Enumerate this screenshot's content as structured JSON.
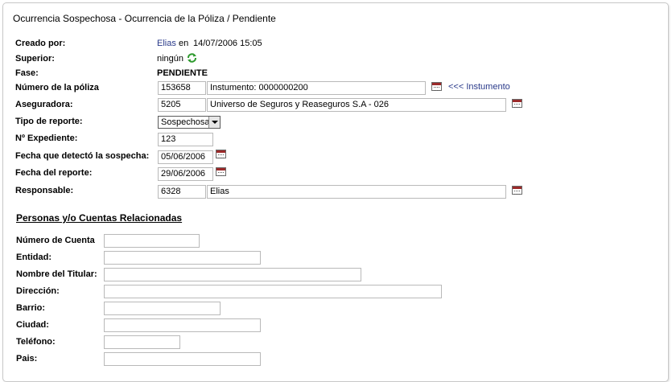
{
  "header": {
    "title": "Ocurrencia Sospechosa - Ocurrencia de la Póliza / Pendiente"
  },
  "form": {
    "creado_por": {
      "label": "Creado por:",
      "user": "Elias",
      "connector": "en",
      "datetime": "14/07/2006 15:05"
    },
    "superior": {
      "label": "Superior:",
      "value": "ningún",
      "icon": "refresh-icon"
    },
    "fase": {
      "label": "Fase:",
      "value": "PENDIENTE"
    },
    "numero_poliza": {
      "label": "Número de la póliza",
      "code": "153658",
      "description": "Instumento: 0000000200",
      "link": "<<< Instumento"
    },
    "aseguradora": {
      "label": "Aseguradora:",
      "code": "5205",
      "name": "Universo de Seguros y Reaseguros S.A - 026"
    },
    "tipo_reporte": {
      "label": "Tipo de reporte:",
      "selected": "Sospechosa"
    },
    "expediente": {
      "label": "Nº Expediente:",
      "value": "123"
    },
    "fecha_detecto": {
      "label": "Fecha que detectó la sospecha:",
      "value": "05/06/2006"
    },
    "fecha_reporte": {
      "label": "Fecha del reporte:",
      "value": "29/06/2006"
    },
    "responsable": {
      "label": "Responsable:",
      "code": "6328",
      "name": "Elias"
    }
  },
  "related": {
    "title": "Personas y/o Cuentas Relacionadas",
    "fields": {
      "numero_cuenta": {
        "label": "Número de Cuenta",
        "value": ""
      },
      "entidad": {
        "label": "Entidad:",
        "value": ""
      },
      "nombre_titular": {
        "label": "Nombre del Titular:",
        "value": ""
      },
      "direccion": {
        "label": "Dirección:",
        "value": ""
      },
      "barrio": {
        "label": "Barrio:",
        "value": ""
      },
      "ciudad": {
        "label": "Ciudad:",
        "value": ""
      },
      "telefono": {
        "label": "Teléfono:",
        "value": ""
      },
      "pais": {
        "label": "Pais:",
        "value": ""
      }
    }
  },
  "colors": {
    "link": "#2a3a8a",
    "calendar_accent": "#9b2a2a",
    "refresh_icon": "#2e9a2e"
  }
}
